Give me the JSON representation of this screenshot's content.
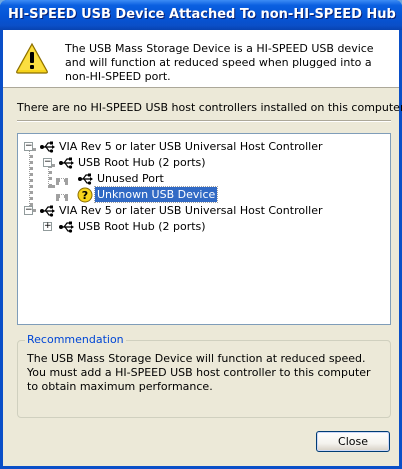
{
  "window": {
    "title": "HI-SPEED USB Device Attached To non-HI-SPEED Hub"
  },
  "header": {
    "warning_icon": "warning-triangle-icon",
    "message": "The USB Mass Storage Device is a HI-SPEED USB device and will function at reduced speed when plugged into a non-HI-SPEED port."
  },
  "info_line": "There are no HI-SPEED USB host controllers installed on this computer.",
  "tree": {
    "nodes": [
      {
        "label": "VIA Rev 5 or later USB Universal Host Controller",
        "icon": "usb-controller-icon",
        "expander": "−"
      },
      {
        "label": "USB Root Hub (2 ports)",
        "icon": "usb-hub-icon",
        "expander": "−"
      },
      {
        "label": "Unused Port",
        "icon": "usb-port-icon"
      },
      {
        "label": "Unknown USB Device",
        "icon": "usb-unknown-device-icon",
        "selected": true
      },
      {
        "label": "VIA Rev 5 or later USB Universal Host Controller",
        "icon": "usb-controller-icon",
        "expander": "−"
      },
      {
        "label": "USB Root Hub (2 ports)",
        "icon": "usb-hub-icon",
        "expander": "+"
      }
    ]
  },
  "recommendation": {
    "title": "Recommendation",
    "text": "The USB Mass Storage Device will function at reduced speed. You must add a HI-SPEED USB host controller to this computer to obtain maximum performance."
  },
  "buttons": {
    "close": "Close"
  },
  "colors": {
    "titlebar": "#0554d6",
    "dialog_bg": "#ece9d8",
    "selection": "#316ac5",
    "group_title": "#0046d5"
  }
}
